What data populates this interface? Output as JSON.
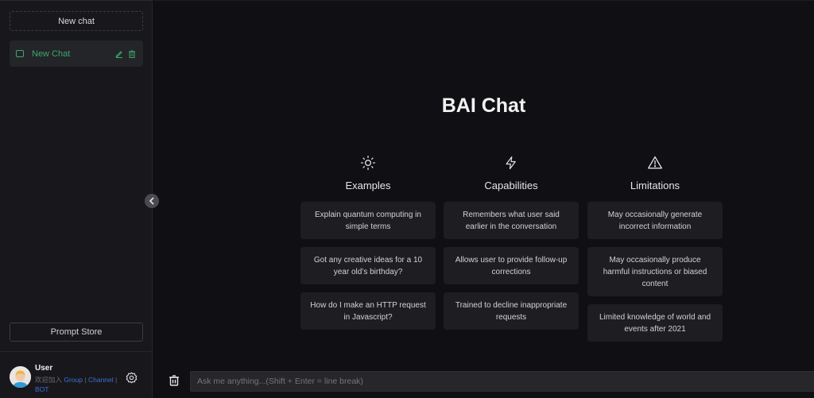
{
  "sidebar": {
    "new_chat_label": "New chat",
    "chats": [
      {
        "title": "New Chat",
        "active": true
      }
    ],
    "prompt_store_label": "Prompt Store",
    "user": {
      "name": "User",
      "desc_prefix": "欢迎加入",
      "links": [
        "Group",
        "Channel",
        "BOT"
      ],
      "separator": "|"
    }
  },
  "main": {
    "title": "BAI Chat",
    "columns": [
      {
        "icon": "sun-icon",
        "title": "Examples",
        "items": [
          "Explain quantum computing in simple terms",
          "Got any creative ideas for a 10 year old’s birthday?",
          "How do I make an HTTP request in Javascript?"
        ]
      },
      {
        "icon": "lightning-icon",
        "title": "Capabilities",
        "items": [
          "Remembers what user said earlier in the conversation",
          "Allows user to provide follow-up corrections",
          "Trained to decline inappropriate requests"
        ]
      },
      {
        "icon": "warning-icon",
        "title": "Limitations",
        "items": [
          "May occasionally generate incorrect information",
          "May occasionally produce harmful instructions or biased content",
          "Limited knowledge of world and events after 2021"
        ]
      }
    ],
    "input": {
      "value": "",
      "placeholder": "Ask me anything...(Shift + Enter = line break)"
    }
  },
  "colors": {
    "accent_green": "#3fa66e",
    "link_blue": "#3d6fd6",
    "background": "#101014",
    "sidebar": "#18181c",
    "card": "#1e1e22"
  }
}
